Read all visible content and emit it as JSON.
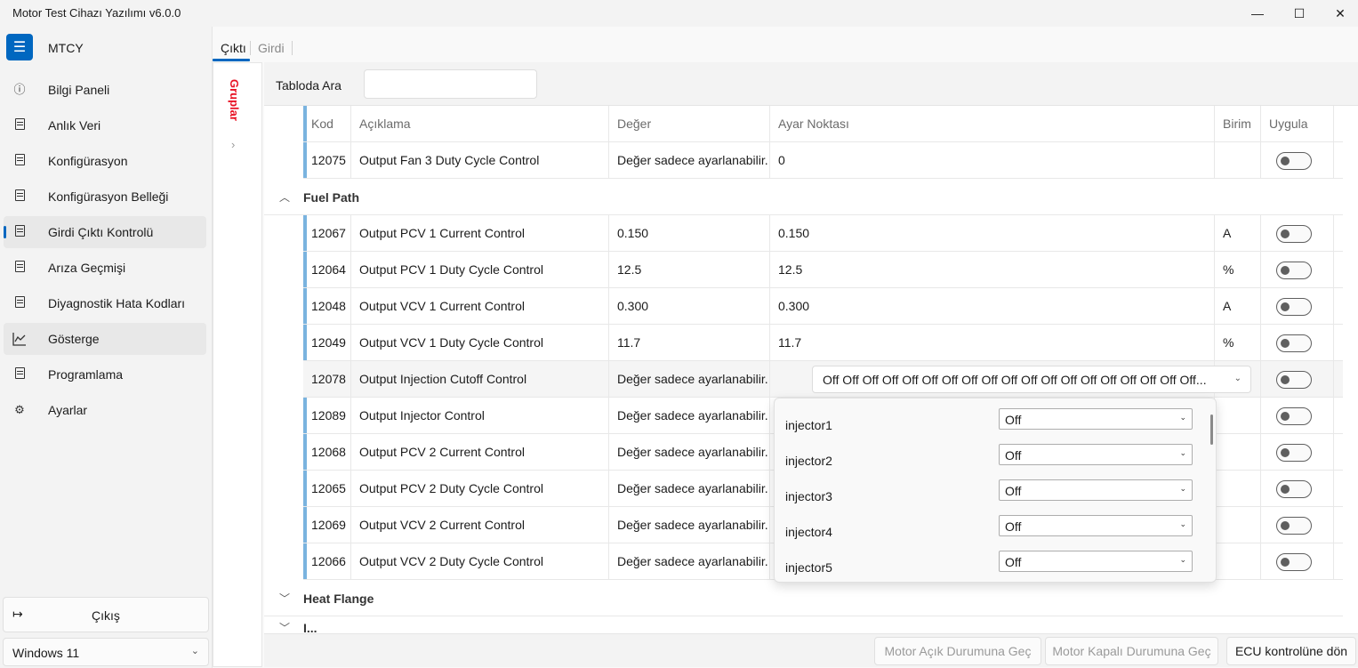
{
  "window": {
    "title": "Motor Test Cihazı Yazılımı v6.0.0",
    "minimize": "—",
    "maximize": "☐",
    "close": "✕"
  },
  "sidebar": {
    "menu_icon": "hamburger-icon",
    "app_name": "MTCY",
    "items": [
      {
        "label": "Bilgi Paneli",
        "icon": "info-icon"
      },
      {
        "label": "Anlık Veri",
        "icon": "document-icon"
      },
      {
        "label": "Konfigürasyon",
        "icon": "document-icon"
      },
      {
        "label": "Konfigürasyon Belleği",
        "icon": "document-icon"
      },
      {
        "label": "Girdi Çıktı Kontrolü",
        "icon": "document-icon"
      },
      {
        "label": "Arıza Geçmişi",
        "icon": "document-icon"
      },
      {
        "label": "Diyagnostik Hata Kodları",
        "icon": "document-icon"
      },
      {
        "label": "Gösterge",
        "icon": "chart-icon"
      },
      {
        "label": "Programlama",
        "icon": "document-icon"
      },
      {
        "label": "Ayarlar",
        "icon": "gears-icon"
      }
    ],
    "active_item": "Girdi Çıktı Kontrolü",
    "exit_label": "Çıkış",
    "theme_value": "Windows 11"
  },
  "tabs": [
    {
      "label": "Çıktı",
      "active": true
    },
    {
      "label": "Girdi",
      "active": false
    }
  ],
  "groups_label": "Gruplar",
  "search": {
    "label": "Tabloda Ara",
    "value": ""
  },
  "table": {
    "headers": {
      "code": "Kod",
      "description": "Açıklama",
      "value": "Değer",
      "setpoint": "Ayar Noktası",
      "unit": "Birim",
      "apply": "Uygula"
    },
    "top_rows": [
      {
        "code": "12075",
        "description": "Output Fan 3 Duty Cycle Control",
        "value": "Değer sadece ayarlanabilir.",
        "setpoint": "0",
        "unit": ""
      }
    ],
    "groups": [
      {
        "name": "Fuel Path",
        "expanded": true,
        "rows": [
          {
            "code": "12067",
            "description": "Output PCV 1 Current Control",
            "value": "0.150",
            "setpoint": "0.150",
            "unit": "A"
          },
          {
            "code": "12064",
            "description": "Output PCV 1 Duty Cycle Control",
            "value": "12.5",
            "setpoint": "12.5",
            "unit": "%"
          },
          {
            "code": "12048",
            "description": "Output VCV 1 Current Control",
            "value": "0.300",
            "setpoint": "0.300",
            "unit": "A"
          },
          {
            "code": "12049",
            "description": "Output VCV 1 Duty Cycle Control",
            "value": "11.7",
            "setpoint": "11.7",
            "unit": "%"
          },
          {
            "code": "12078",
            "description": "Output Injection Cutoff Control",
            "value": "Değer sadece ayarlanabilir.",
            "setpoint": "Off Off Off Off Off Off Off Off Off Off Off Off Off Off Off Off Off Off Off...",
            "unit": ""
          },
          {
            "code": "12089",
            "description": "Output Injector Control",
            "value": "Değer sadece ayarlanabilir.",
            "setpoint": "",
            "unit": ""
          },
          {
            "code": "12068",
            "description": "Output PCV 2 Current Control",
            "value": "Değer sadece ayarlanabilir.",
            "setpoint": "",
            "unit": ""
          },
          {
            "code": "12065",
            "description": "Output PCV 2 Duty Cycle Control",
            "value": "Değer sadece ayarlanabilir.",
            "setpoint": "",
            "unit": ""
          },
          {
            "code": "12069",
            "description": "Output VCV 2 Current Control",
            "value": "Değer sadece ayarlanabilir.",
            "setpoint": "",
            "unit": ""
          },
          {
            "code": "12066",
            "description": "Output VCV 2 Duty Cycle Control",
            "value": "Değer sadece ayarlanabilir.",
            "setpoint": "",
            "unit": ""
          }
        ]
      },
      {
        "name": "Heat Flange",
        "expanded": false,
        "rows": []
      },
      {
        "name": "I...",
        "expanded": false,
        "rows": []
      }
    ]
  },
  "dropdown_popup": {
    "items": [
      {
        "name": "injector1",
        "value": "Off"
      },
      {
        "name": "injector2",
        "value": "Off"
      },
      {
        "name": "injector3",
        "value": "Off"
      },
      {
        "name": "injector4",
        "value": "Off"
      },
      {
        "name": "injector5",
        "value": "Off"
      }
    ]
  },
  "bottom_buttons": {
    "engine_on": "Motor Açık Durumuna Geç",
    "engine_off": "Motor Kapalı Durumuna Geç",
    "ecu_return": "ECU kontrolüne dön"
  },
  "colors": {
    "accent": "#0067c0",
    "groups_label": "#e81123",
    "row_accent": "#7ab3df"
  }
}
